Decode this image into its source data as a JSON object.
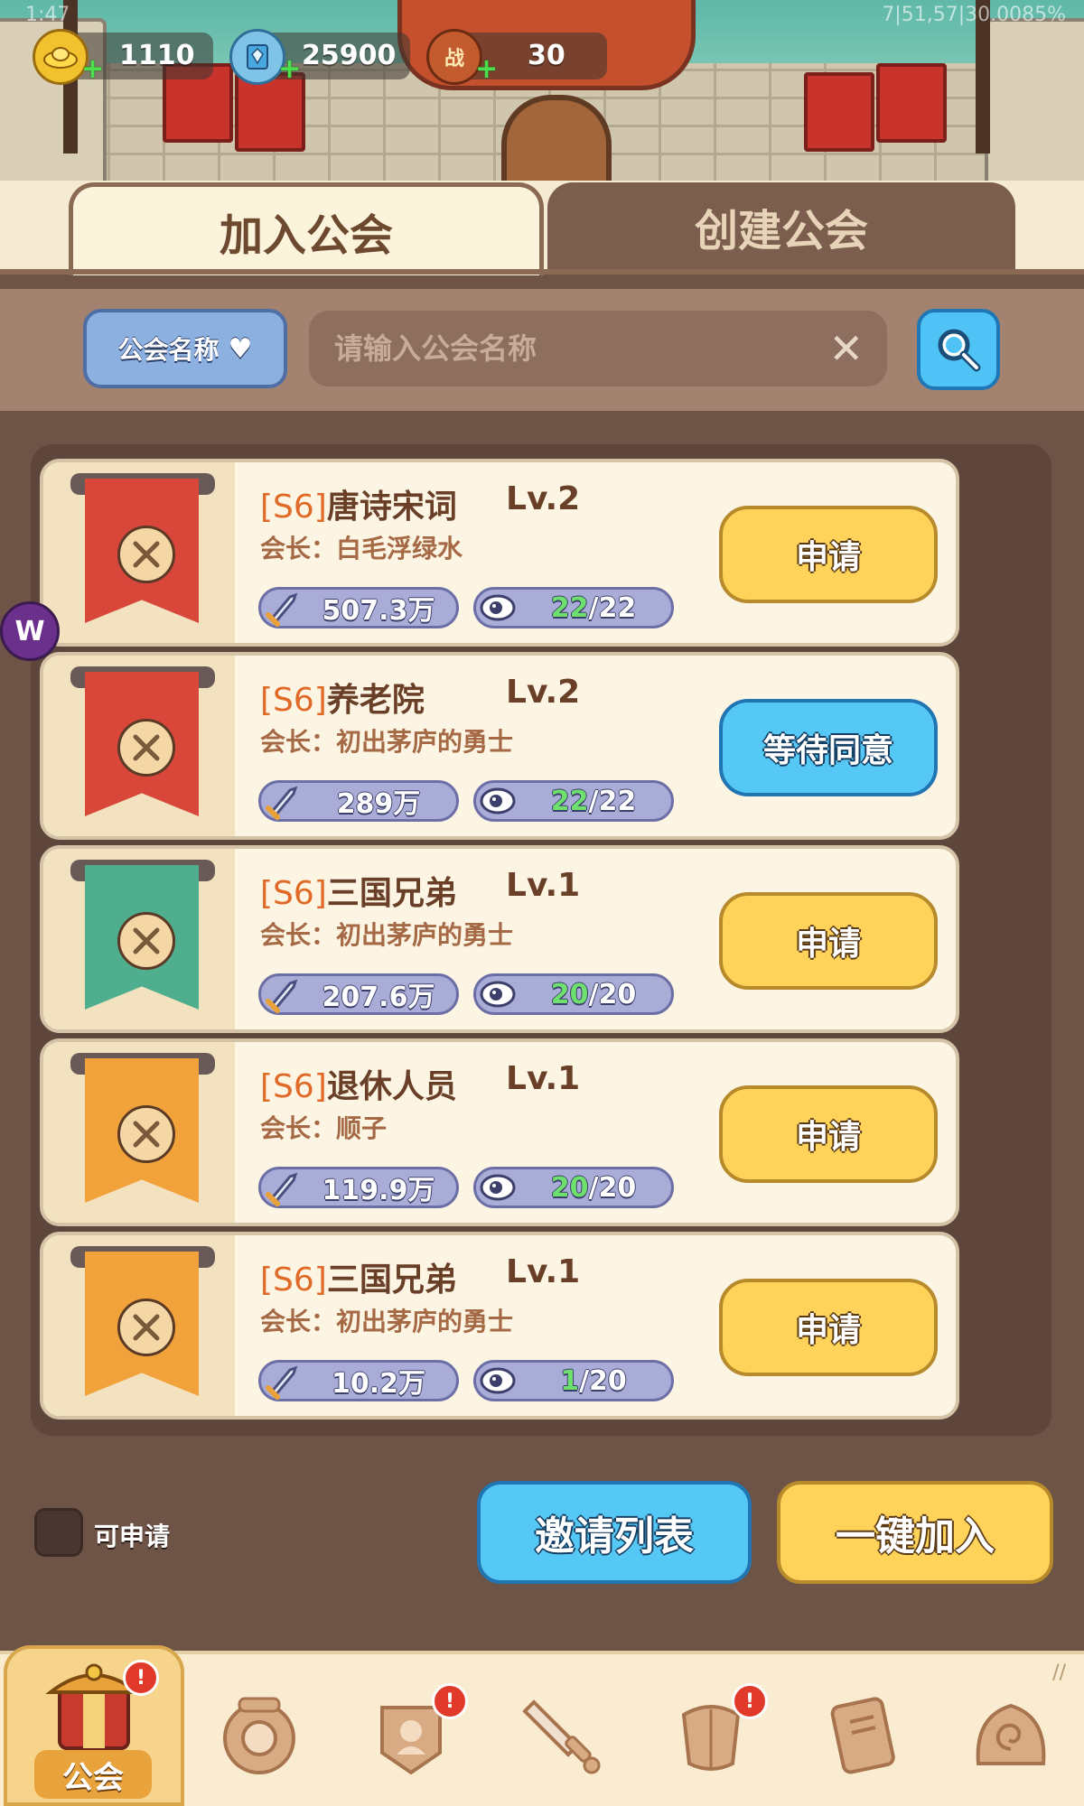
{
  "status_bar": {
    "time": "1:47",
    "right": "7|51,57|30.0085%"
  },
  "resources": [
    {
      "icon": "gold-ingot-icon",
      "value": "1110"
    },
    {
      "icon": "diamond-book-icon",
      "value": "25900"
    },
    {
      "icon": "battle-token-icon",
      "glyph": "战",
      "value": "30"
    }
  ],
  "tabs": {
    "join": "加入公会",
    "create": "创建公会"
  },
  "search": {
    "filter_label": "公会名称",
    "placeholder": "请输入公会名称",
    "value": ""
  },
  "guilds": [
    {
      "server": "[S6]",
      "name": "唐诗宋词",
      "level": "Lv.2",
      "leader": "会长：白毛浮绿水",
      "power": "507.3万",
      "members_current": "22",
      "members_max": "/22",
      "button": "申请",
      "button_style": "yellow",
      "banner_color": "#d8473a",
      "emblem": "cat-hero-emblem"
    },
    {
      "server": "[S6]",
      "name": "养老院",
      "level": "Lv.2",
      "leader": "会长：初出茅庐的勇士",
      "power": "289万",
      "members_current": "22",
      "members_max": "/22",
      "button": "等待同意",
      "button_style": "blue",
      "banner_color": "#d8473a",
      "emblem": "ogre-face-emblem"
    },
    {
      "server": "[S6]",
      "name": "三国兄弟",
      "level": "Lv.1",
      "leader": "会长：初出茅庐的勇士",
      "power": "207.6万",
      "members_current": "20",
      "members_max": "/20",
      "button": "申请",
      "button_style": "yellow",
      "banner_color": "#4fae8e",
      "emblem": "crossed-swords-emblem"
    },
    {
      "server": "[S6]",
      "name": "退休人员",
      "level": "Lv.1",
      "leader": "会长：顺子",
      "power": "119.9万",
      "members_current": "20",
      "members_max": "/20",
      "button": "申请",
      "button_style": "yellow",
      "banner_color": "#f2a23a",
      "emblem": "horse-head-emblem"
    },
    {
      "server": "[S6]",
      "name": "三国兄弟",
      "level": "Lv.1",
      "leader": "会长：初出茅庐的勇士",
      "power": "10.2万",
      "members_current": "1",
      "members_max": "/20",
      "button": "申请",
      "button_style": "yellow",
      "banner_color": "#f2a23a",
      "emblem": "crossed-swords-emblem"
    }
  ],
  "floating_badge": "W",
  "bottom_actions": {
    "checkbox_label": "可申请",
    "invite_list": "邀请列表",
    "quick_join": "一键加入"
  },
  "nav": {
    "active_label": "公会",
    "items": [
      "guild-icon",
      "shield-icon",
      "hero-card-icon",
      "sword-icon",
      "armor-icon",
      "book-icon",
      "spiral-shell-icon"
    ],
    "alert_mark": "!",
    "corner_mark": "//"
  },
  "colors": {
    "accent_yellow": "#ffd25a",
    "accent_blue": "#55c8f5",
    "panel_brown": "#5e463c",
    "server_orange": "#e06a28"
  }
}
